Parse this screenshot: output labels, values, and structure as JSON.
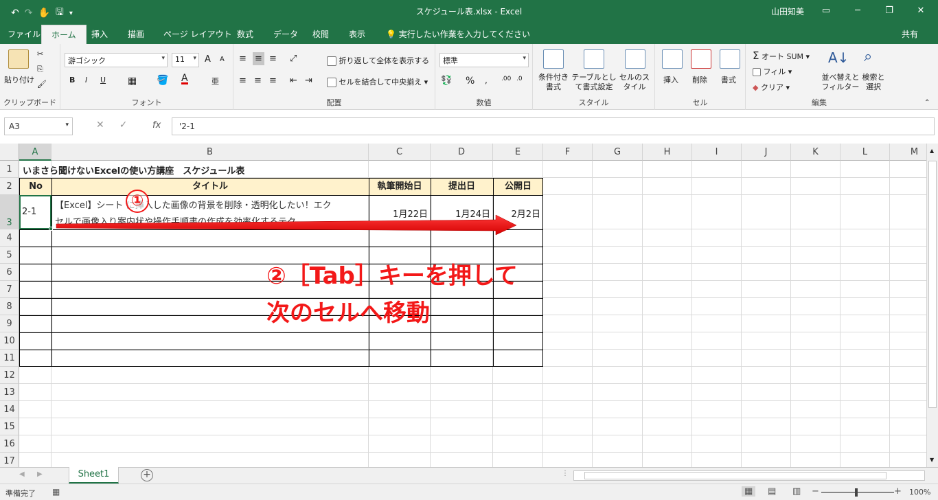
{
  "window": {
    "doc_title": "スケジュール表.xlsx - Excel",
    "user": "山田知美",
    "minimize": "─",
    "restore": "❐",
    "close": "✕"
  },
  "qat": {
    "undo": "↶",
    "redo": "↷",
    "touch": "✋",
    "save": "🖫",
    "more": "▾"
  },
  "menu": {
    "tabs": [
      "ファイル",
      "ホーム",
      "挿入",
      "描画",
      "ページ レイアウト",
      "数式",
      "データ",
      "校閲",
      "表示",
      "💡 実行したい作業を入力してください"
    ],
    "active": "ホーム",
    "share": "共有"
  },
  "ribbon": {
    "clipboard": {
      "label": "クリップボード",
      "paste": "貼り付け"
    },
    "font": {
      "label": "フォント",
      "name": "游ゴシック",
      "size": "11",
      "bold": "B",
      "italic": "I",
      "underline": "U",
      "grow": "A",
      "shrink": "A"
    },
    "alignment": {
      "label": "配置",
      "wrap": "折り返して全体を表示する",
      "merge": "セルを結合して中央揃え"
    },
    "number": {
      "label": "数値",
      "format": "標準",
      "percent": "%"
    },
    "styles": {
      "label": "スタイル",
      "cond": "条件付き書式",
      "table": "テーブルとして書式設定",
      "cell": "セルのスタイル"
    },
    "cells": {
      "label": "セル",
      "insert": "挿入",
      "delete": "削除",
      "format": "書式"
    },
    "editing": {
      "label": "編集",
      "autosum": "オート SUM",
      "fill": "フィル",
      "clear": "クリア",
      "sort": "並べ替えとフィルター",
      "find": "検索と選択"
    }
  },
  "formula_bar": {
    "name_box": "A3",
    "content": "'2-1",
    "fx": "fx"
  },
  "grid": {
    "columns": [
      "A",
      "B",
      "C",
      "D",
      "E",
      "F",
      "G",
      "H",
      "I",
      "J",
      "K",
      "L",
      "M"
    ],
    "rows": [
      "1",
      "2",
      "3",
      "4",
      "5",
      "6",
      "7",
      "8",
      "9",
      "10",
      "11",
      "12",
      "13",
      "14",
      "15",
      "16",
      "17"
    ],
    "title": "いまさら聞けないExcelの使い方講座　スケジュール表",
    "headers": {
      "no": "No",
      "title": "タイトル",
      "start": "執筆開始日",
      "submit": "提出日",
      "publish": "公開日"
    },
    "row3": {
      "no": "2-1",
      "title_line1": "【Excel】シート に挿入した画像の背景を削除・透明化したい！エク",
      "title_line2": "セルで画像入り案内状や操作手順書の作成を効率化するテク",
      "start": "1月22日",
      "submit": "1月24日",
      "publish": "2月2日"
    }
  },
  "annotations": {
    "step1": "①",
    "callout_line1": "②［Tab］キーを押して",
    "callout_line2": "次のセルへ移動"
  },
  "sheets": {
    "tabs": [
      "Sheet1"
    ],
    "add": "+"
  },
  "status": {
    "text": "準備完了",
    "zoom": "100%"
  }
}
